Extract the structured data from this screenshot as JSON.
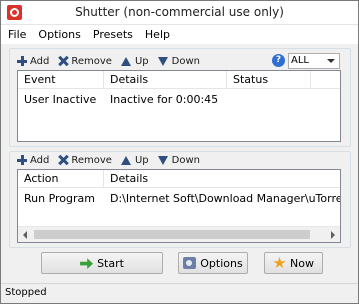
{
  "window": {
    "title": "Shutter (non-commercial use only)"
  },
  "menu": {
    "items": [
      "File",
      "Options",
      "Presets",
      "Help"
    ]
  },
  "events_toolbar": {
    "add": "Add",
    "remove": "Remove",
    "up": "Up",
    "down": "Down",
    "filter": "ALL"
  },
  "events_list": {
    "columns": [
      "Event",
      "Details",
      "Status"
    ],
    "rows": [
      {
        "event": "User Inactive",
        "details": "Inactive for 0:00:45",
        "status": ""
      }
    ]
  },
  "actions_toolbar": {
    "add": "Add",
    "remove": "Remove",
    "up": "Up",
    "down": "Down"
  },
  "actions_list": {
    "columns": [
      "Action",
      "Details"
    ],
    "rows": [
      {
        "action": "Run Program",
        "details": "D:\\Internet Soft\\Download Manager\\uTorrent\\"
      }
    ]
  },
  "buttons": {
    "start": "Start",
    "options": "Options",
    "now": "Now"
  },
  "status": {
    "text": "Stopped"
  },
  "colors": {
    "app_icon": "#d9342b",
    "toolbar_icon": "#2f4f80",
    "help_icon": "#2e6fd1",
    "start_icon": "#3aa13a",
    "now_icon": "#f0a020"
  },
  "icons": {
    "app": "shutter-app-icon",
    "add": "plus-icon",
    "remove": "x-icon",
    "up": "arrow-up-icon",
    "down": "arrow-down-icon",
    "help": "help-icon",
    "start": "start-arrow-icon",
    "options": "options-icon",
    "now": "star-icon"
  }
}
